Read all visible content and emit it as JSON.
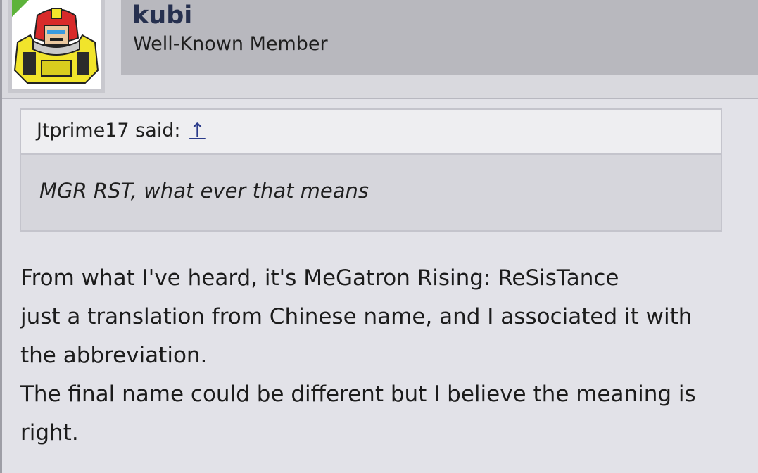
{
  "user": {
    "name": "kubi",
    "title": "Well-Known Member"
  },
  "quote": {
    "author": "Jtprime17",
    "said": "said:",
    "jump_symbol": "↑",
    "text": "MGR RST, what ever that means"
  },
  "message": {
    "lines": [
      "From what I've heard, it's MeGatron Rising: ReSisTance",
      "just a translation from Chinese name, and I associated it with",
      "the abbreviation.",
      "The final name could be different but I believe the meaning is",
      "right."
    ]
  },
  "colors": {
    "background": "#e2e2e8",
    "username": "#26304f",
    "online_badge": "#5db33a",
    "link": "#2a3a8a"
  },
  "icons": {
    "avatar": "robot-avatar",
    "jump": "arrow-up-icon"
  }
}
